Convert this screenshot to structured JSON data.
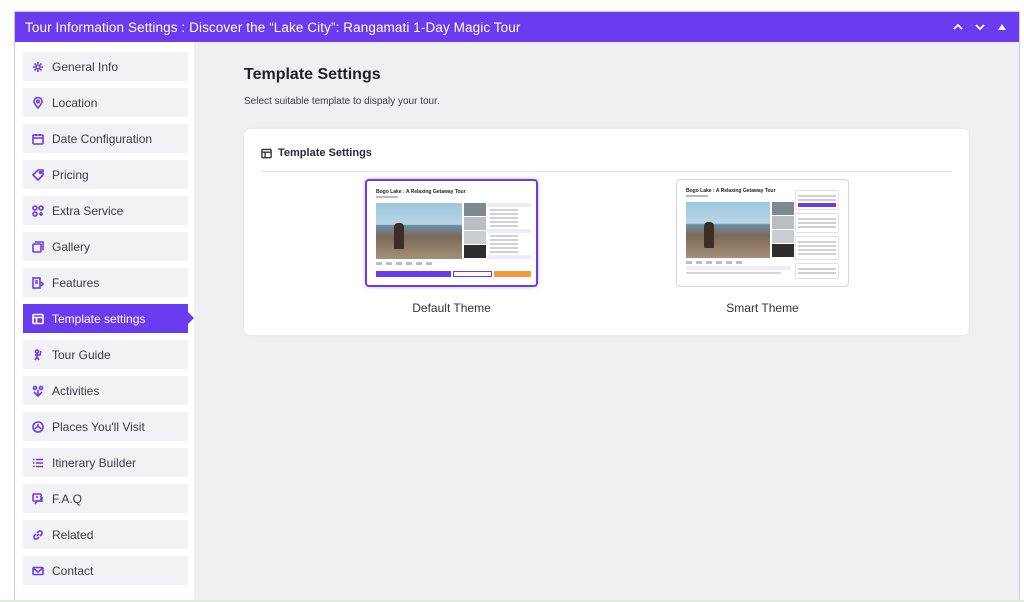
{
  "titlebar": {
    "title": "Tour Information Settings : Discover the “Lake City”: Rangamati 1-Day Magic Tour",
    "color": "#6b3bef",
    "controls": [
      "chevron-up-icon",
      "chevron-down-icon",
      "triangle-up-icon"
    ]
  },
  "sidebar": {
    "items": [
      {
        "label": "General Info",
        "icon": "gear-icon"
      },
      {
        "label": "Location",
        "icon": "location-pin-icon"
      },
      {
        "label": "Date Configuration",
        "icon": "calendar-icon"
      },
      {
        "label": "Pricing",
        "icon": "price-tag-icon"
      },
      {
        "label": "Extra Service",
        "icon": "grid-plus-icon"
      },
      {
        "label": "Gallery",
        "icon": "gallery-icon"
      },
      {
        "label": "Features",
        "icon": "features-icon"
      },
      {
        "label": "Template settings",
        "icon": "template-icon",
        "active": true
      },
      {
        "label": "Tour Guide",
        "icon": "tour-guide-icon"
      },
      {
        "label": "Activities",
        "icon": "activities-icon"
      },
      {
        "label": "Places You'll Visit",
        "icon": "places-icon"
      },
      {
        "label": "Itinerary Builder",
        "icon": "list-icon"
      },
      {
        "label": "F.A.Q",
        "icon": "faq-icon"
      },
      {
        "label": "Related",
        "icon": "link-icon"
      },
      {
        "label": "Contact",
        "icon": "mail-icon"
      }
    ]
  },
  "main": {
    "title": "Template Settings",
    "subtitle": "Select suitable template to dispaly your tour.",
    "card": {
      "heading": "Template Settings",
      "themes": [
        {
          "label": "Default Theme",
          "preview_title": "Bogo Lake : A Relaxing Getaway Tour",
          "selected": true
        },
        {
          "label": "Smart Theme",
          "preview_title": "Bogo Lake : A Relaxing Getaway Tour",
          "selected": false
        }
      ]
    }
  }
}
